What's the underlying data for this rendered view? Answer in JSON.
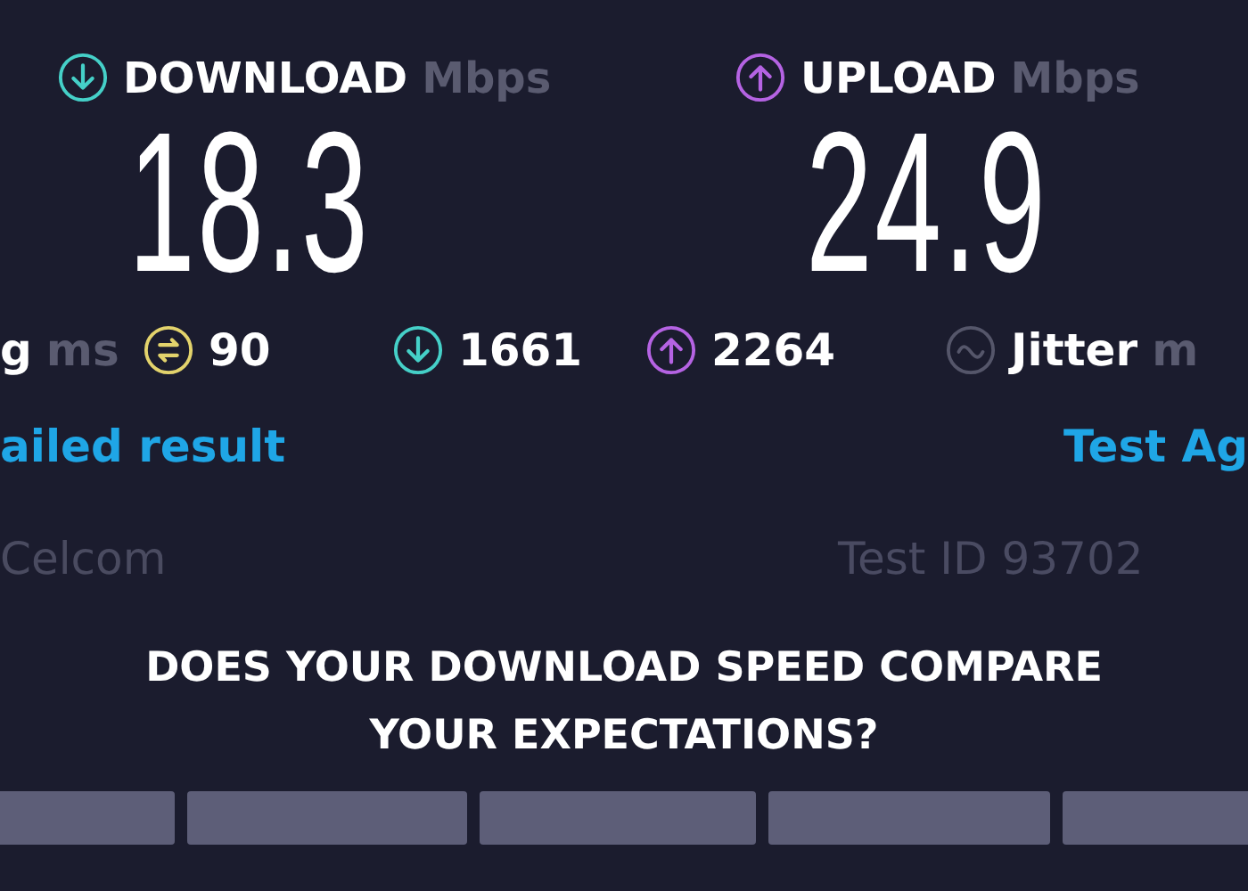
{
  "results": [
    {
      "kind": "download",
      "label": "DOWNLOAD",
      "unit": "Mbps",
      "value": "18.3"
    },
    {
      "kind": "upload",
      "label": "UPLOAD",
      "unit": "Mbps",
      "value": "24.9"
    }
  ],
  "metrics": [
    {
      "kind": "text",
      "label": "g",
      "unit": "ms"
    },
    {
      "kind": "ping",
      "value": "90"
    },
    {
      "kind": "download",
      "value": "1661"
    },
    {
      "kind": "upload",
      "value": "2264"
    },
    {
      "kind": "jitter",
      "label": "Jitter",
      "unit": "m"
    }
  ],
  "links": [
    "ailed result",
    "Test Ag"
  ],
  "provider": "Celcom",
  "test_id": "Test ID 93702",
  "question": [
    "DOES YOUR DOWNLOAD SPEED COMPARE",
    "YOUR EXPECTATIONS?"
  ]
}
